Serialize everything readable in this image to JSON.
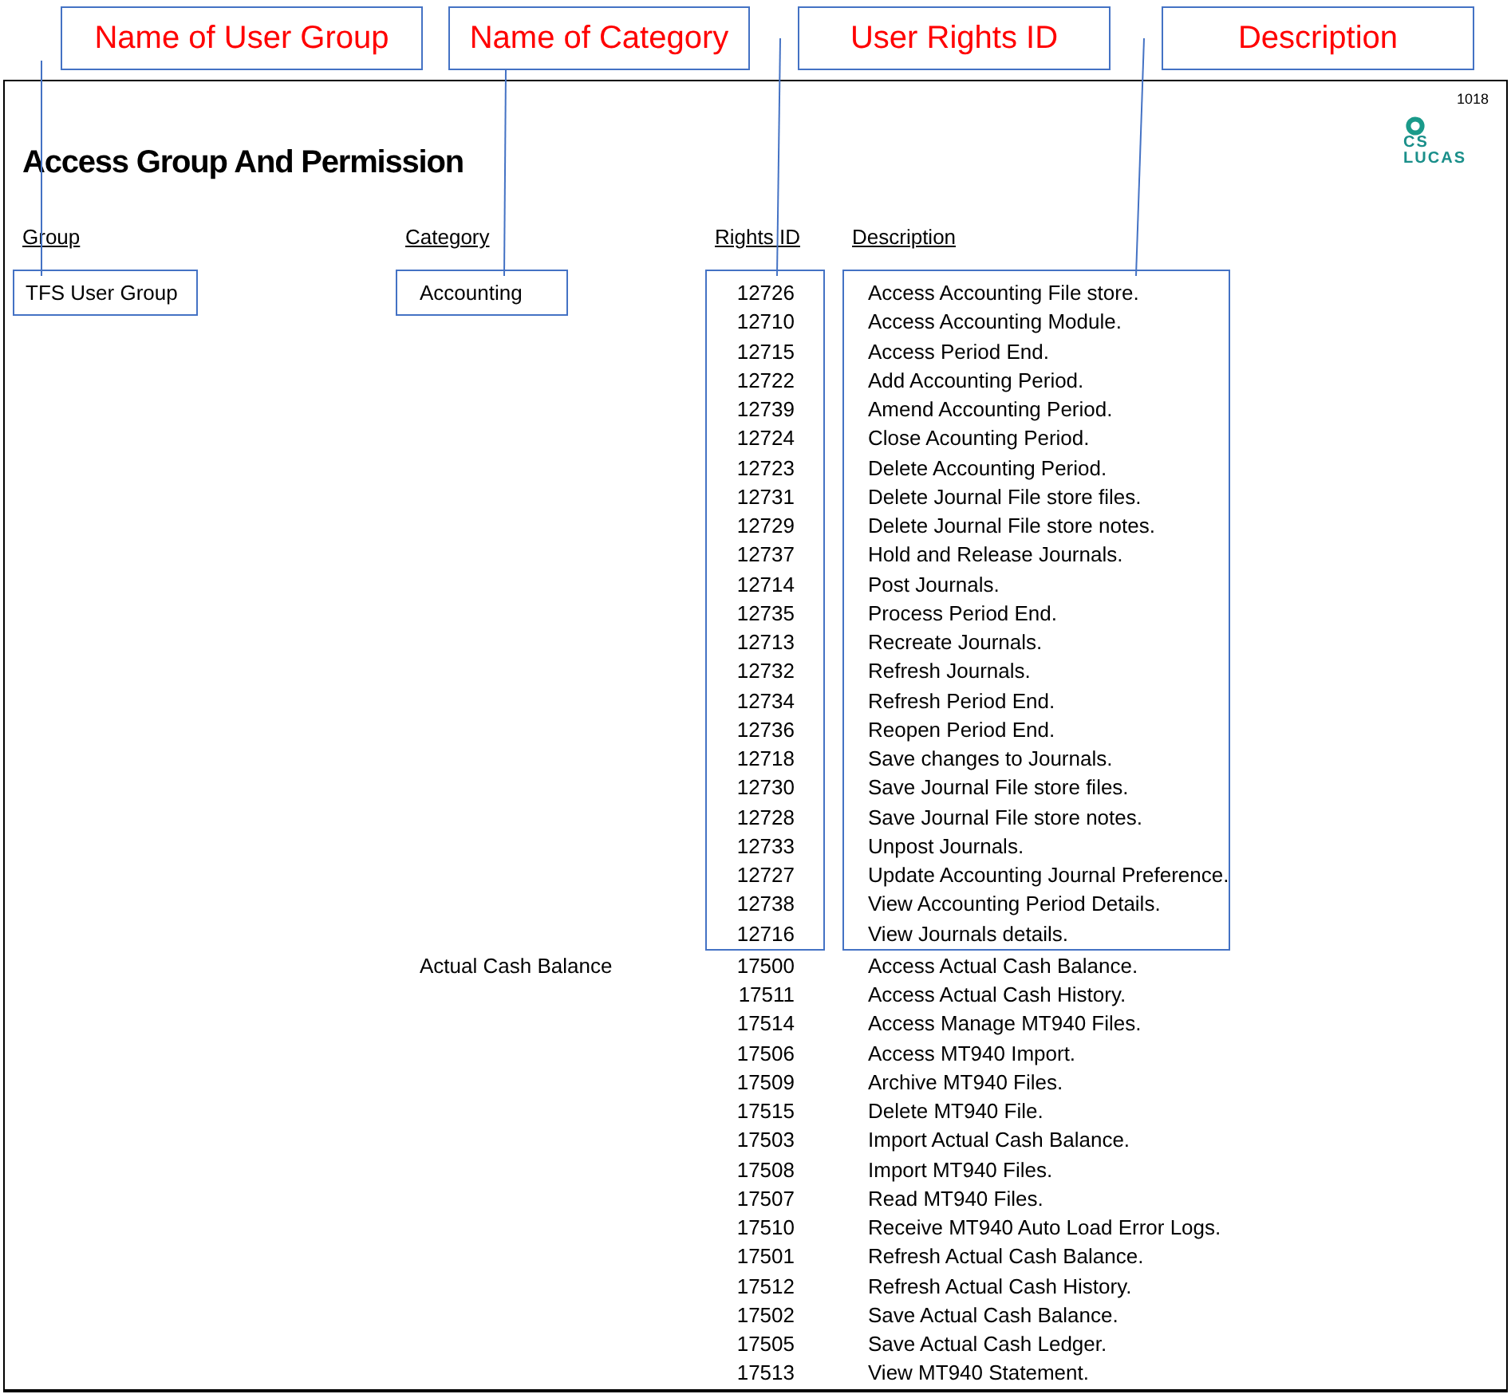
{
  "callouts": [
    {
      "label": "Name of User Group"
    },
    {
      "label": "Name of Category"
    },
    {
      "label": "User Rights ID"
    },
    {
      "label": "Description"
    }
  ],
  "report": {
    "page_number": "1018",
    "title": "Access Group And Permission",
    "logo": {
      "lines": [
        "CS",
        "LUCAS"
      ]
    },
    "columns": [
      "Group",
      "Category",
      "Rights ID",
      "Description"
    ],
    "groups": [
      {
        "name": "TFS User Group",
        "highlighted": true,
        "categories": [
          {
            "name": "Accounting",
            "highlighted": true,
            "rights": [
              {
                "id": "12726",
                "description": "Access Accounting File store."
              },
              {
                "id": "12710",
                "description": "Access Accounting Module."
              },
              {
                "id": "12715",
                "description": "Access Period End."
              },
              {
                "id": "12722",
                "description": "Add Accounting Period."
              },
              {
                "id": "12739",
                "description": "Amend Accounting Period."
              },
              {
                "id": "12724",
                "description": "Close Acounting Period."
              },
              {
                "id": "12723",
                "description": "Delete Accounting Period."
              },
              {
                "id": "12731",
                "description": "Delete Journal File store files."
              },
              {
                "id": "12729",
                "description": "Delete Journal File store notes."
              },
              {
                "id": "12737",
                "description": "Hold and Release Journals."
              },
              {
                "id": "12714",
                "description": "Post Journals."
              },
              {
                "id": "12735",
                "description": "Process Period End."
              },
              {
                "id": "12713",
                "description": "Recreate Journals."
              },
              {
                "id": "12732",
                "description": "Refresh Journals."
              },
              {
                "id": "12734",
                "description": "Refresh Period End."
              },
              {
                "id": "12736",
                "description": "Reopen Period End."
              },
              {
                "id": "12718",
                "description": "Save changes to Journals."
              },
              {
                "id": "12730",
                "description": "Save Journal File store files."
              },
              {
                "id": "12728",
                "description": "Save Journal File store notes."
              },
              {
                "id": "12733",
                "description": "Unpost Journals."
              },
              {
                "id": "12727",
                "description": "Update Accounting Journal Preference."
              },
              {
                "id": "12738",
                "description": "View Accounting Period Details."
              },
              {
                "id": "12716",
                "description": "View Journals details."
              }
            ]
          },
          {
            "name": "Actual Cash Balance",
            "highlighted": false,
            "rights": [
              {
                "id": "17500",
                "description": "Access Actual Cash Balance."
              },
              {
                "id": "17511",
                "description": "Access Actual Cash History."
              },
              {
                "id": "17514",
                "description": "Access Manage MT940 Files."
              },
              {
                "id": "17506",
                "description": "Access MT940 Import."
              },
              {
                "id": "17509",
                "description": "Archive MT940 Files."
              },
              {
                "id": "17515",
                "description": "Delete MT940 File."
              },
              {
                "id": "17503",
                "description": "Import Actual Cash Balance."
              },
              {
                "id": "17508",
                "description": "Import MT940 Files."
              },
              {
                "id": "17507",
                "description": "Read MT940 Files."
              },
              {
                "id": "17510",
                "description": "Receive MT940 Auto Load Error Logs."
              },
              {
                "id": "17501",
                "description": "Refresh Actual Cash Balance."
              },
              {
                "id": "17512",
                "description": "Refresh Actual Cash History."
              },
              {
                "id": "17502",
                "description": "Save Actual Cash Balance."
              },
              {
                "id": "17505",
                "description": "Save Actual Cash Ledger."
              },
              {
                "id": "17513",
                "description": "View MT940 Statement."
              }
            ]
          }
        ]
      }
    ]
  }
}
